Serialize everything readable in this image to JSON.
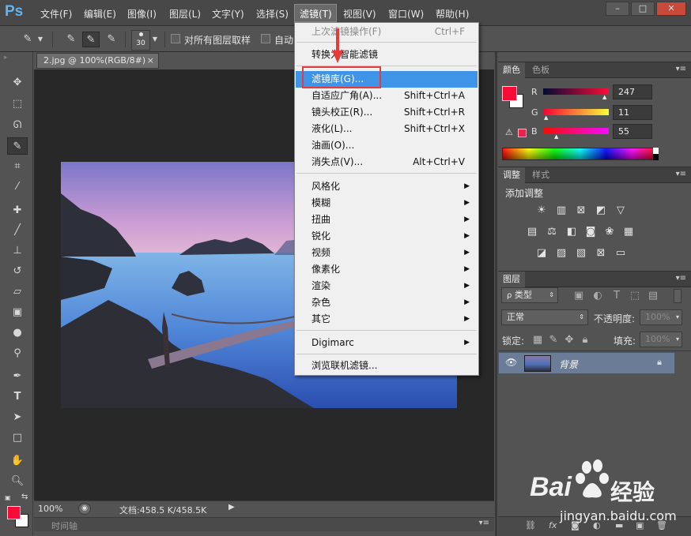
{
  "app": {
    "logo": "Ps",
    "menu": [
      "文件(F)",
      "编辑(E)",
      "图像(I)",
      "图层(L)",
      "文字(Y)",
      "选择(S)",
      "滤镜(T)",
      "视图(V)",
      "窗口(W)",
      "帮助(H)"
    ],
    "window_controls": [
      "–",
      "□",
      "✕"
    ]
  },
  "options_bar": {
    "brush_size": "30",
    "sample_all_layers": "对所有图层取样",
    "auto_label": "自动"
  },
  "document": {
    "tab_title": "2.jpg @ 100%(RGB/8#)",
    "tab_close": "×",
    "zoom": "100%",
    "doc_size": "文档:458.5 K/458.5K",
    "timeline_label": "时间轴"
  },
  "filter_menu": {
    "last_filter": {
      "label": "上次滤镜操作(F)",
      "shortcut": "Ctrl+F"
    },
    "convert_smart": "转换为智能滤镜",
    "items_group1": [
      {
        "label": "滤镜库(G)...",
        "shortcut": ""
      },
      {
        "label": "自适应广角(A)...",
        "shortcut": "Shift+Ctrl+A"
      },
      {
        "label": "镜头校正(R)...",
        "shortcut": "Shift+Ctrl+R"
      },
      {
        "label": "液化(L)...",
        "shortcut": "Shift+Ctrl+X"
      },
      {
        "label": "油画(O)...",
        "shortcut": ""
      },
      {
        "label": "消失点(V)...",
        "shortcut": "Alt+Ctrl+V"
      }
    ],
    "submenus": [
      "风格化",
      "模糊",
      "扭曲",
      "锐化",
      "视频",
      "像素化",
      "渲染",
      "杂色",
      "其它"
    ],
    "digimarc": "Digimarc",
    "browse_online": "浏览联机滤镜..."
  },
  "color_panel": {
    "tabs": [
      "颜色",
      "色板"
    ],
    "r_label": "R",
    "g_label": "G",
    "b_label": "B",
    "r": "247",
    "g": "11",
    "b": "55",
    "foreground_hex": "#f70b37"
  },
  "adjustments_panel": {
    "tabs": [
      "调整",
      "样式"
    ],
    "title": "添加调整"
  },
  "layers_panel": {
    "tab": "图层",
    "filter_kind": "类型",
    "blend_mode": "正常",
    "opacity_label": "不透明度:",
    "opacity_value": "100%",
    "lock_label": "锁定:",
    "fill_label": "填充:",
    "fill_value": "100%",
    "layer_name": "背景"
  },
  "watermark": {
    "brand": "Bai",
    "brand2": "经验",
    "url": "jingyan.baidu.com"
  }
}
